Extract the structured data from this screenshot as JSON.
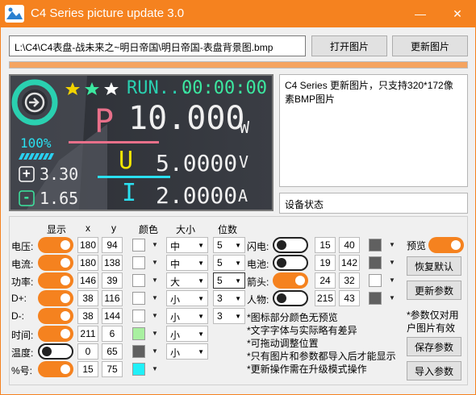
{
  "window": {
    "title": "C4 Series picture update 3.0",
    "minimize_glyph": "—",
    "close_glyph": "✕",
    "accent": "#f5821f"
  },
  "file": {
    "path": "L:\\C4\\C4表盘-战未来之~明日帝国\\明日帝国-表盘背景图.bmp",
    "open_label": "打开图片",
    "update_label": "更新图片",
    "progress": 1.0
  },
  "preview": {
    "status_text": "RUN...",
    "timer": "00:00:00",
    "percent": "100%",
    "plus_value": "3.30",
    "minus_value": "1.65",
    "p_letter": "P",
    "p_value": "10.000",
    "p_unit": "W",
    "u_letter": "U",
    "u_value": "5.0000",
    "u_unit": "V",
    "i_letter": "I",
    "i_value": "2.0000",
    "i_unit": "A",
    "plus_glyph": "+",
    "minus_glyph": "-",
    "colors": {
      "p": "#e8708a",
      "u": "#f2e600",
      "i": "#2ae0f0",
      "ring": "#2ad0b0",
      "star": "#f2d300",
      "timer": "#3ce8a0"
    }
  },
  "info_text": "C4 Series 更新图片，只支持320*172像素BMP图片",
  "status_label": "设备状态",
  "headers": {
    "show": "显示",
    "x": "x",
    "y": "y",
    "color": "颜色",
    "size": "大小",
    "digits": "位数"
  },
  "rows": [
    {
      "label": "电压:",
      "on": true,
      "x": "180",
      "y": "94",
      "color": "#ffffff",
      "size": "中",
      "digits": "5"
    },
    {
      "label": "电流:",
      "on": true,
      "x": "180",
      "y": "138",
      "color": "#ffffff",
      "size": "中",
      "digits": "5"
    },
    {
      "label": "功率:",
      "on": true,
      "x": "146",
      "y": "39",
      "color": "#ffffff",
      "size": "大",
      "digits": "5"
    },
    {
      "label": "D+:",
      "on": true,
      "x": "38",
      "y": "116",
      "color": "#ffffff",
      "size": "小",
      "digits": "3"
    },
    {
      "label": "D-:",
      "on": true,
      "x": "38",
      "y": "144",
      "color": "#ffffff",
      "size": "小",
      "digits": "3"
    },
    {
      "label": "时间:",
      "on": true,
      "x": "211",
      "y": "6",
      "color": "#a8f0a0",
      "size": "小",
      "digits": ""
    },
    {
      "label": "温度:",
      "on": false,
      "x": "0",
      "y": "65",
      "color": "#606060",
      "size": "小",
      "digits": ""
    },
    {
      "label": "%号:",
      "on": true,
      "x": "15",
      "y": "75",
      "color": "#20f0f8",
      "size": "",
      "digits": ""
    }
  ],
  "right_rows": [
    {
      "label": "闪电:",
      "on": false,
      "x": "15",
      "y": "40",
      "color": "#606060"
    },
    {
      "label": "电池:",
      "on": false,
      "x": "19",
      "y": "142",
      "color": "#606060"
    },
    {
      "label": "箭头:",
      "on": true,
      "x": "24",
      "y": "32",
      "color": "#ffffff"
    },
    {
      "label": "人物:",
      "on": false,
      "x": "215",
      "y": "43",
      "color": "#606060"
    }
  ],
  "notes": [
    "*图标部分颜色无预览",
    "*文字字体与实际略有差异",
    "*可拖动调整位置",
    "*只有图片和参数都导入后才能显示",
    "*更新操作需在升级模式操作"
  ],
  "side": {
    "preview_label": "预览",
    "preview_on": true,
    "restore_label": "恢复默认",
    "update_params_label": "更新参数",
    "note_line1": "*参数仅对用",
    "note_line2": "户图片有效",
    "save_label": "保存参数",
    "import_label": "导入参数"
  }
}
